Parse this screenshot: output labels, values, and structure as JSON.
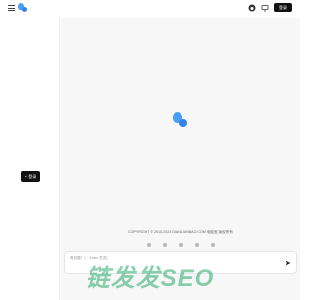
{
  "header": {
    "login_label": "登录",
    "icons": [
      "menu-icon",
      "logo-icon",
      "github-icon",
      "monitor-icon"
    ]
  },
  "sidebar": {
    "login_label": "+ 登录"
  },
  "main": {
    "copyright": "COPYRIGHT © 2015-2024 DIANLIANBAO.COM 电脑宝 版权所有",
    "footer_icons": [
      "settings-icon",
      "link-icon",
      "user-icon",
      "help-icon",
      "info-icon"
    ],
    "input_placeholder": "有问题？(... Enter 发送)"
  },
  "watermark": {
    "text": "链发发SEO",
    "color": "#28aa69"
  },
  "colors": {
    "brand": "#4a9ff5",
    "button_bg": "#111111",
    "page_bg": "#f7f7f8"
  }
}
